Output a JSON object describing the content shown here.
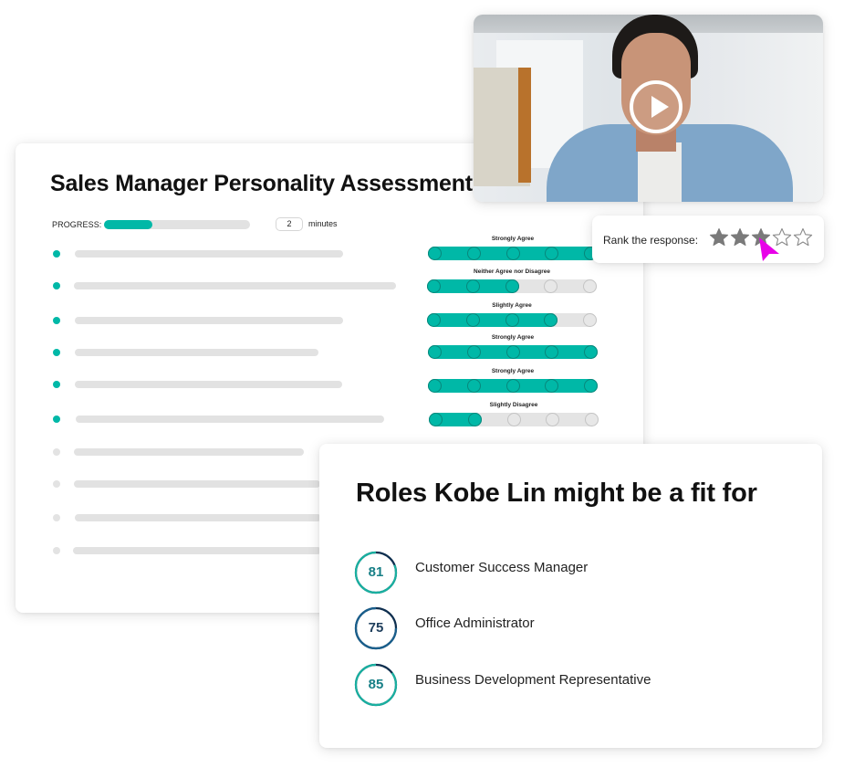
{
  "colors": {
    "accent": "#00b8a7",
    "track": "#e2e2e2",
    "ring_teal": "#19b0a0",
    "ring_blue": "#1a5f8c",
    "ring_dark": "#0f2f4f",
    "cursor": "#e800e8",
    "star_filled": "#7a7a7a"
  },
  "assessment": {
    "title": "Sales Manager Personality Assessment",
    "progress_label": "PROGRESS:",
    "progress_fraction": 0.33,
    "minutes_value": "2",
    "minutes_label": "minutes",
    "questions": [
      {
        "answered": true,
        "scale_label": "Strongly Agree",
        "selected": 5
      },
      {
        "answered": true,
        "scale_label": "Neither Agree nor Disagree",
        "selected": 3
      },
      {
        "answered": true,
        "scale_label": "Slightly Agree",
        "selected": 4
      },
      {
        "answered": true,
        "scale_label": "Strongly Agree",
        "selected": 5
      },
      {
        "answered": true,
        "scale_label": "Strongly Agree",
        "selected": 5
      },
      {
        "answered": true,
        "scale_label": "Slightly Disagree",
        "selected": 2
      },
      {
        "answered": false
      },
      {
        "answered": false
      },
      {
        "answered": false
      },
      {
        "answered": false
      }
    ],
    "scale_points": 5
  },
  "video": {
    "play_icon": "play-icon"
  },
  "rank": {
    "label": "Rank the response:",
    "rating": 3,
    "max": 5
  },
  "roles": {
    "title": "Roles Kobe Lin might be a fit for",
    "items": [
      {
        "score": "81",
        "name": "Customer Success Manager",
        "tone": "teal"
      },
      {
        "score": "75",
        "name": "Office Administrator",
        "tone": "blue"
      },
      {
        "score": "85",
        "name": "Business Development Representative",
        "tone": "teal"
      }
    ]
  }
}
